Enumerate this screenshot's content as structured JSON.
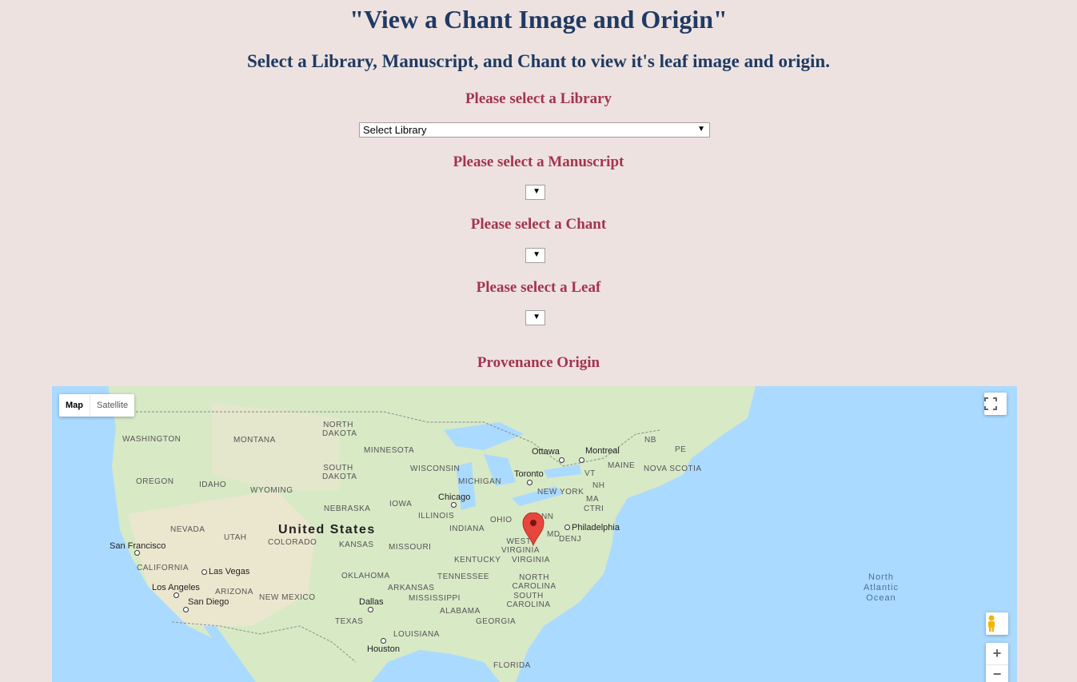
{
  "page": {
    "title": "\"View a Chant Image and Origin\"",
    "subtitle": "Select a Library, Manuscript, and Chant to view it's leaf image and origin."
  },
  "form": {
    "library_label": "Please select a Library",
    "library_value": "Select Library",
    "manuscript_label": "Please select a Manuscript",
    "chant_label": "Please select a Chant",
    "leaf_label": "Please select a Leaf"
  },
  "provenance": {
    "label": "Provenance Origin"
  },
  "map": {
    "type_map": "Map",
    "type_satellite": "Satellite",
    "zoom_in": "+",
    "zoom_out": "−",
    "country": "United States",
    "ocean": "North Atlantic Ocean",
    "states": {
      "washington": "WASHINGTON",
      "montana": "MONTANA",
      "north_dakota": "NORTH DAKOTA",
      "minnesota": "MINNESOTA",
      "south_dakota": "SOUTH DAKOTA",
      "wisconsin": "WISCONSIN",
      "michigan": "MICHIGAN",
      "oregon": "OREGON",
      "idaho": "IDAHO",
      "wyoming": "WYOMING",
      "nebraska": "NEBRASKA",
      "iowa": "IOWA",
      "illinois": "ILLINOIS",
      "nevada": "NEVADA",
      "utah": "UTAH",
      "colorado": "COLORADO",
      "kansas": "KANSAS",
      "missouri": "MISSOURI",
      "indiana": "INDIANA",
      "ohio": "OHIO",
      "california": "CALIFORNIA",
      "arizona": "ARIZONA",
      "new_mexico": "NEW MEXICO",
      "oklahoma": "OKLAHOMA",
      "arkansas": "ARKANSAS",
      "tennessee": "TENNESSEE",
      "kentucky": "KENTUCKY",
      "west_virginia": "WEST VIRGINIA",
      "virginia": "VIRGINIA",
      "north_carolina": "NORTH CAROLINA",
      "south_carolina": "SOUTH CAROLINA",
      "mississippi": "MISSISSIPPI",
      "alabama": "ALABAMA",
      "georgia": "GEORGIA",
      "louisiana": "LOUISIANA",
      "texas": "TEXAS",
      "florida": "FLORIDA",
      "new_york": "NEW YORK",
      "pa": "NN",
      "md": "MD",
      "dej": "DENJ",
      "ma": "MA",
      "ctri": "CTRI",
      "vt": "VT",
      "nh": "NH",
      "maine": "MAINE",
      "nb": "NB",
      "pe": "PE",
      "nova_scotia": "NOVA SCOTIA"
    },
    "cities": {
      "ottawa": "Ottawa",
      "montreal": "Montreal",
      "toronto": "Toronto",
      "chicago": "Chicago",
      "philadelphia": "Philadelphia",
      "san_francisco": "San Francisco",
      "las_vegas": "Las Vegas",
      "los_angeles": "Los Angeles",
      "san_diego": "San Diego",
      "dallas": "Dallas",
      "houston": "Houston"
    },
    "colors": {
      "land": "#d8e9c6",
      "water": "#aadaff",
      "desert": "#ede7cf",
      "marker": "#e8453c"
    }
  }
}
